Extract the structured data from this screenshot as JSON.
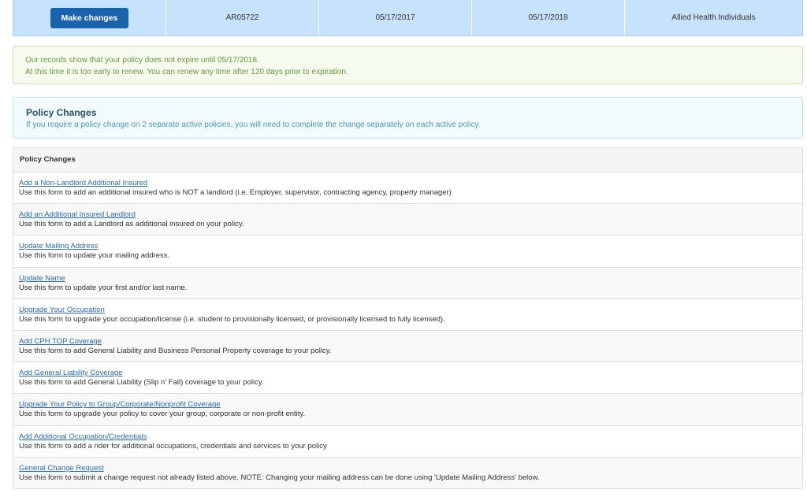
{
  "policy_row": {
    "button_label": "Make changes",
    "policy_number": "AR05722",
    "effective_date": "05/17/2017",
    "expiration_date": "05/17/2018",
    "program": "Allied Health Individuals"
  },
  "renewal_notice": {
    "line1": "Our records show that your policy does not expire until 05/17/2018.",
    "line2": "At this time it is too early to renew. You can renew any time after 120 days prior to expiration."
  },
  "policy_changes_info": {
    "title": "Policy Changes",
    "message": "If you require a policy change on 2 separate active policies, you will need to complete the change separately on each active policy."
  },
  "changes_panel": {
    "heading": "Policy Changes",
    "items": [
      {
        "link": "Add a Non-Landlord Additional Insured",
        "description": "Use this form to add an additional insured who is NOT a landlord (i.e. Employer, supervisor, contracting agency, property manager)"
      },
      {
        "link": "Add an Additional Insured Landlord",
        "description": "Use this form to add a Landlord as additional insured on your policy."
      },
      {
        "link": "Update Mailing Address",
        "description": "Use this form to update your mailing address."
      },
      {
        "link": "Update Name",
        "description": "Use this form to update your first and/or last name."
      },
      {
        "link": "Upgrade Your Occupation",
        "description": "Use this form to upgrade your occupation/license (i.e. student to provisionally licensed, or provisionally licensed to fully licensed)."
      },
      {
        "link": "Add CPH TOP Coverage",
        "description": "Use this form to add General Liability and Business Personal Property coverage to your policy."
      },
      {
        "link": "Add General Liability Coverage",
        "description": "Use this form to add General Liability (Slip n' Fall) coverage to your policy."
      },
      {
        "link": "Upgrade Your Policy to Group/Corporate/Nonprofit Coverage",
        "description": "Use this form to upgrade your policy to cover your group, corporate or non-profit entity."
      },
      {
        "link": "Add Additional Occupation/Credentials",
        "description": "Use this form to add a rider for additional occupations, credentials and services to your policy"
      },
      {
        "link": "General Change Request",
        "description": "Use this form to submit a change request not already listed above. NOTE: Changing your mailing address can be done using 'Update Mailing Address' below."
      }
    ]
  }
}
